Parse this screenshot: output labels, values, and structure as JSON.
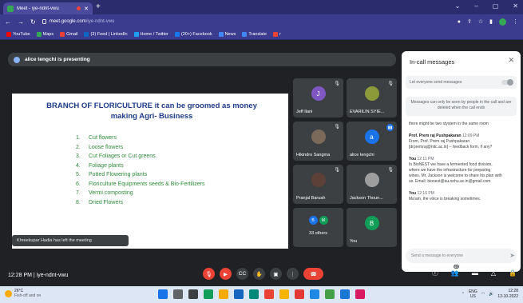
{
  "browser": {
    "tab_title": "Meet - iye-ndnt-vwu",
    "url_host": "meet.google.com",
    "url_path": "/iye-ndnt-vwu",
    "bookmarks": [
      {
        "label": "YouTube",
        "color": "#ff0000"
      },
      {
        "label": "Maps",
        "color": "#34a853"
      },
      {
        "label": "Gmail",
        "color": "#ea4335"
      },
      {
        "label": "(3) Feed | LinkedIn",
        "color": "#0a66c2"
      },
      {
        "label": "Home / Twitter",
        "color": "#1da1f2"
      },
      {
        "label": "(20+) Facebook",
        "color": "#1877f2"
      },
      {
        "label": "News",
        "color": "#4285f4"
      },
      {
        "label": "Translate",
        "color": "#4285f4"
      },
      {
        "label": "r",
        "color": "#ea4335"
      }
    ]
  },
  "meet": {
    "presenting_text": "alice tengchi is presenting",
    "meeting_time": "12:28 PM",
    "meeting_code": "iye-ndnt-vwu",
    "toast": "Khreekupar Hadia has left the meeting",
    "slide": {
      "title": "BRANCH OF FLORICULTURE it can be groomed as money making Agri- Business",
      "items": [
        "Cut flowers",
        "Loose flowers",
        "Cut Foliages or Cut greens",
        "Foliage plants",
        "Potted Flowering plants",
        "Floriculture Equipments seeds & Bio-Fertilizers",
        "Vermi composting",
        "Dried Flowers"
      ]
    },
    "participants": [
      {
        "name": "Jeff Ilani",
        "initial": "J",
        "color": "#7e57c2"
      },
      {
        "name": "EVARILIN SYIE...",
        "initial": "",
        "color": "#8d9a3a"
      },
      {
        "name": "Hikindro Sangma",
        "initial": "",
        "color": "#7b6a5a"
      },
      {
        "name": "alice tengchi",
        "initial": "a",
        "color": "#1a73e8"
      },
      {
        "name": "Pranjal Baruah",
        "initial": "",
        "color": "#5d4037"
      },
      {
        "name": "Jackson Thoun...",
        "initial": "",
        "color": "#9e9e9e"
      },
      {
        "name": "33 others",
        "initial": "",
        "color": ""
      },
      {
        "name": "You",
        "initial": "B",
        "color": "#0f9d58"
      }
    ],
    "others_initials": [
      "B",
      "M"
    ],
    "people_count": "40"
  },
  "chat": {
    "title": "In-call messages",
    "toggle_label": "Let everyone send messages",
    "info": "Messages can only be seen by people in the call and are deleted when the call ends",
    "messages": [
      {
        "author": "",
        "time": "",
        "lines": [
          "there might be two stystem in the same room"
        ]
      },
      {
        "author": "Prof. Prem raj Pushpakaran",
        "time": "12:09 PM",
        "lines": [
          "From, Prof. Prem raj Pushpakaran",
          "[drpremraj@nitc.ac.in] -- feedback form, if any?"
        ]
      },
      {
        "author": "You",
        "time": "12:11 PM",
        "lines": [
          "In BioNEST we have a fermented food division,",
          "where we have the infrastructure for preparing",
          "wines. Mr. Jackson is welcome to share his plan with",
          "us. Email: bionest@au.nehu.ac.in@gmail.com"
        ]
      },
      {
        "author": "You",
        "time": "12:16 PM",
        "lines": [
          "Ma'am, the voice is breaking sometimes."
        ]
      }
    ],
    "input_placeholder": "Send a message to everyone"
  },
  "taskbar": {
    "weather_temp": "26°C",
    "weather_desc": "Fish-off and on",
    "lang_top": "ENG",
    "lang_bottom": "US",
    "time": "12:28",
    "date": "12-10-2022"
  }
}
